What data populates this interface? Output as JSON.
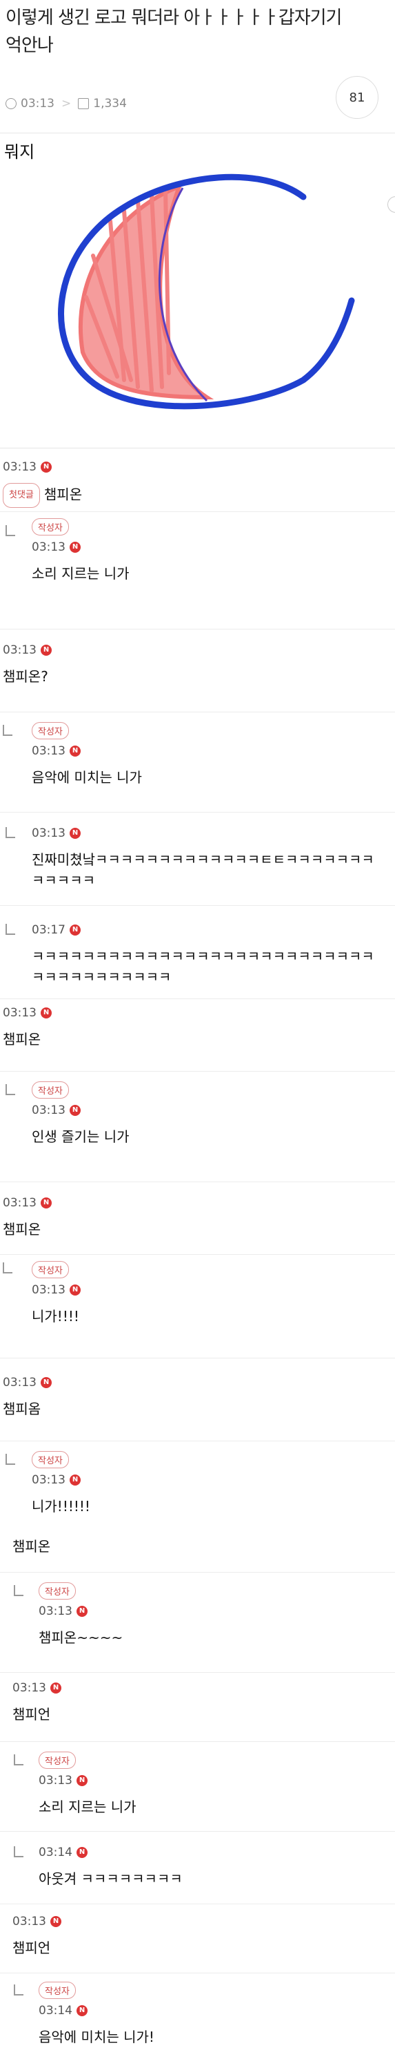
{
  "post": {
    "title": "이렇게 생긴 로고 뭐더라 아ㅏㅏㅏㅏㅏ갑자기기억안나",
    "time": "03:13",
    "views": "1,334",
    "comment_count": "81",
    "body_text": "뭐지"
  },
  "labels": {
    "author_tag": "작성자",
    "first_tag": "첫댓글",
    "n_badge": "N"
  },
  "comments": [
    {
      "time": "03:13",
      "text": "챔피온"
    },
    {
      "time": "03:13",
      "text": "소리 지르는 니가"
    },
    {
      "time": "03:13",
      "text": "챔피온?"
    },
    {
      "time": "03:13",
      "text": "음악에 미치는 니가"
    },
    {
      "time": "03:13",
      "text": "진짜미쳤낰ㅋㅋㅋㅋㅋㅋㅋㅋㅋㅋㅋㅋㅋㅌㅌㅋㅋㅋㅋㅋㅋㅋㅋㅋㅋㅋㅋ"
    },
    {
      "time": "03:17",
      "text": "ㅋㅋㅋㅋㅋㅋㅋㅋㅋㅋㅋㅋㅋㅋㅋㅋㅋㅋㅋㅋㅋㅋㅋㅋㅋㅋㅋㅋㅋㅋㅋㅋㅋㅋㅋㅋㅋㅋ"
    },
    {
      "time": "03:13",
      "text": "챔피온"
    },
    {
      "time": "03:13",
      "text": "인생 즐기는 니가"
    },
    {
      "time": "03:13",
      "text": "챔피온"
    },
    {
      "time": "03:13",
      "text": "니가!!!!"
    },
    {
      "time": "03:13",
      "text": "챔피옴"
    },
    {
      "time": "03:13",
      "text": "니가!!!!!!"
    },
    {
      "time": "",
      "text": "챔피온"
    },
    {
      "time": "03:13",
      "text": "챔피온~~~~"
    },
    {
      "time": "03:13",
      "text": "챔피언"
    },
    {
      "time": "03:13",
      "text": "소리 지르는 니가"
    },
    {
      "time": "03:14",
      "text": "아웃겨 ㅋㅋㅋㅋㅋㅋㅋㅋ"
    },
    {
      "time": "03:13",
      "text": "챔피언"
    },
    {
      "time": "03:14",
      "text": "음악에 미치는 니가!"
    }
  ]
}
